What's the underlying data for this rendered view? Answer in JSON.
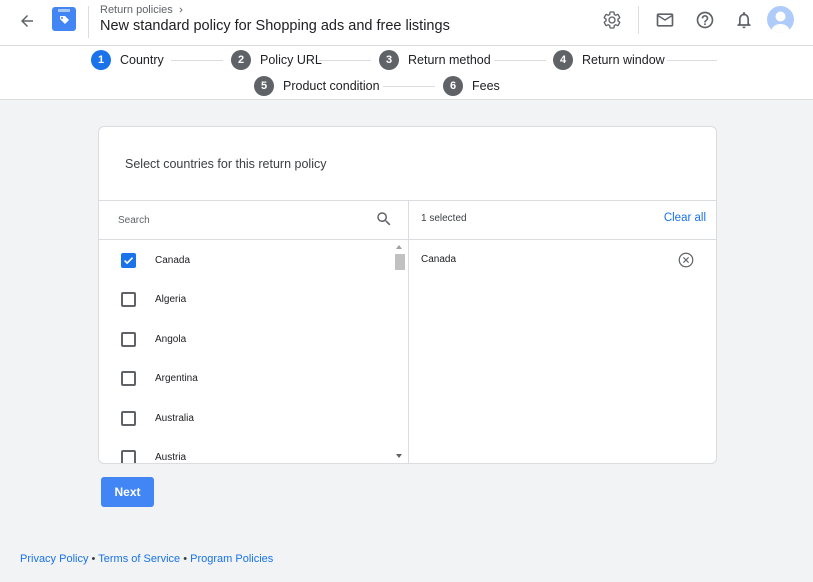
{
  "header": {
    "breadcrumb": "Return policies",
    "title": "New standard policy for Shopping ads and free listings"
  },
  "stepper": {
    "steps": [
      {
        "num": "1",
        "label": "Country"
      },
      {
        "num": "2",
        "label": "Policy URL"
      },
      {
        "num": "3",
        "label": "Return method"
      },
      {
        "num": "4",
        "label": "Return window"
      },
      {
        "num": "5",
        "label": "Product condition"
      },
      {
        "num": "6",
        "label": "Fees"
      }
    ]
  },
  "card": {
    "title": "Select countries for this return policy",
    "search_placeholder": "Search",
    "selected_count": "1 selected",
    "clear_all": "Clear all",
    "countries": [
      {
        "name": "Canada",
        "checked": true
      },
      {
        "name": "Algeria",
        "checked": false
      },
      {
        "name": "Angola",
        "checked": false
      },
      {
        "name": "Argentina",
        "checked": false
      },
      {
        "name": "Australia",
        "checked": false
      },
      {
        "name": "Austria",
        "checked": false
      }
    ],
    "selected": [
      "Canada"
    ]
  },
  "actions": {
    "next_label": "Next"
  },
  "footer": {
    "privacy": "Privacy Policy",
    "terms": "Terms of Service",
    "program": "Program Policies",
    "separator": "•"
  },
  "colors": {
    "accent": "#1a73e8",
    "button": "#4285f4",
    "step_inactive": "#5f6368"
  }
}
